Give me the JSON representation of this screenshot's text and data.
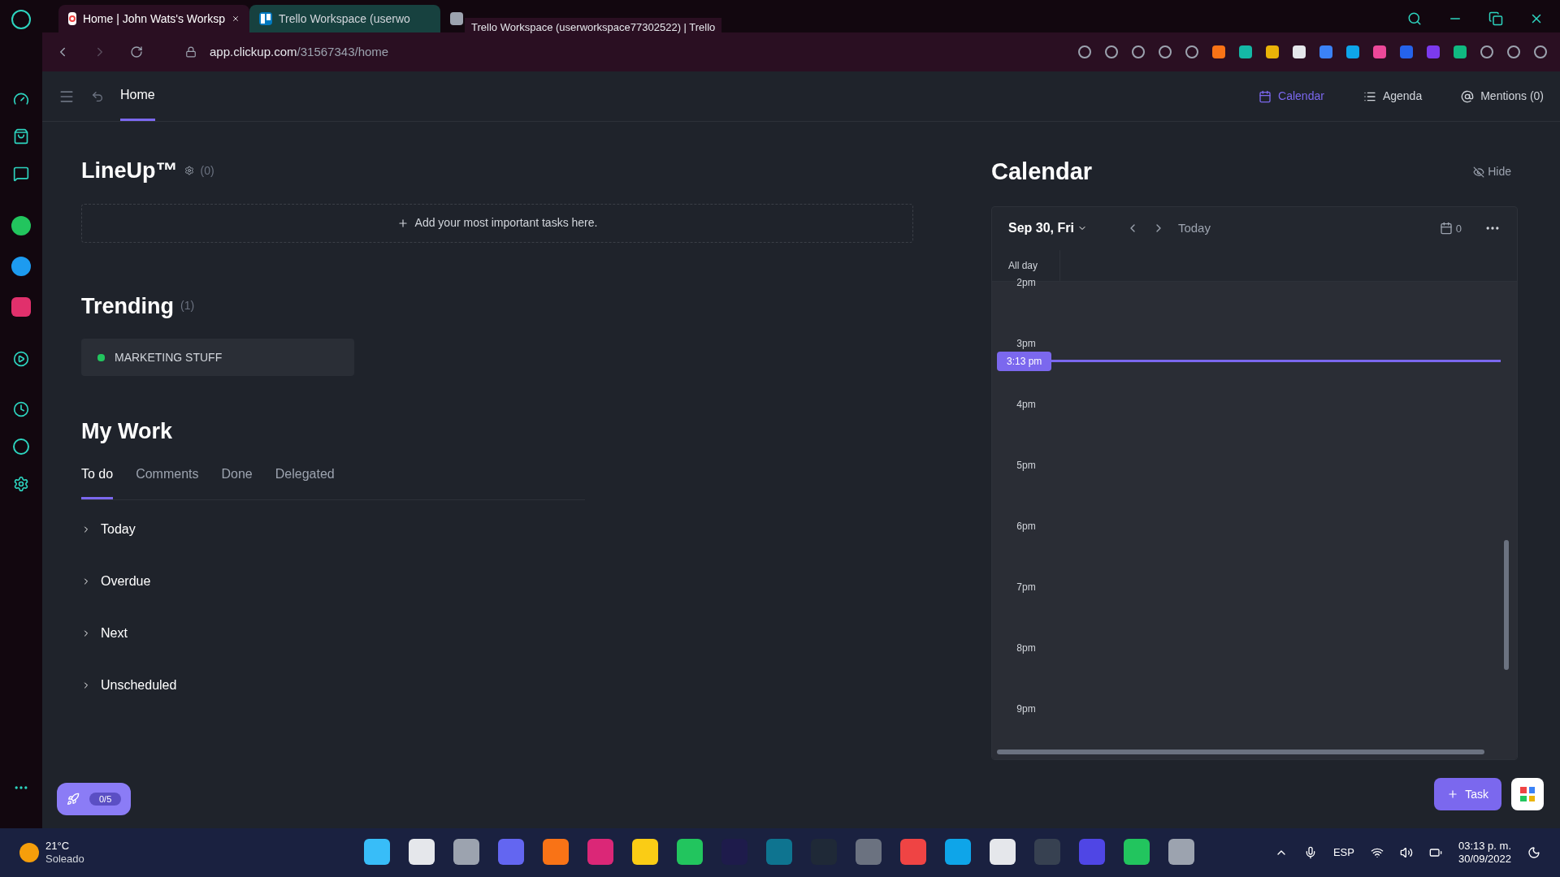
{
  "browser": {
    "tabs": [
      {
        "title": "Home | John Wats's Worksp",
        "selected": true,
        "kind": "clickup"
      },
      {
        "title": "Trello Workspace (userwo",
        "selected": false,
        "kind": "trello"
      },
      {
        "selected": false,
        "kind": "other"
      }
    ],
    "tooltip": "Trello Workspace (userworkspace77302522) | Trello",
    "url_host": "app.clickup.com",
    "url_path": "/31567343/home"
  },
  "header": {
    "title": "Home",
    "views": [
      {
        "label": "Calendar",
        "selected": true
      },
      {
        "label": "Agenda",
        "selected": false
      },
      {
        "label": "Mentions (0)",
        "selected": false
      }
    ]
  },
  "lineup": {
    "title": "LineUp™",
    "count": "(0)",
    "add_label": "Add your most important tasks here."
  },
  "trending": {
    "title": "Trending",
    "count": "(1)",
    "items": [
      {
        "label": "MARKETING STUFF",
        "color": "#22c55e"
      }
    ]
  },
  "my_work": {
    "title": "My Work",
    "tabs": [
      {
        "label": "To do",
        "selected": true
      },
      {
        "label": "Comments",
        "selected": false
      },
      {
        "label": "Done",
        "selected": false
      },
      {
        "label": "Delegated",
        "selected": false
      }
    ],
    "groups": [
      {
        "label": "Today",
        "expanded": false
      },
      {
        "label": "Overdue",
        "expanded": false
      },
      {
        "label": "Next",
        "expanded": false
      },
      {
        "label": "Unscheduled",
        "expanded": false
      }
    ]
  },
  "calendar": {
    "title": "Calendar",
    "hide_label": "Hide",
    "date": "Sep 30, Fri",
    "today_label": "Today",
    "event_count": "0",
    "all_day": "All day",
    "hours": [
      "2pm",
      "3pm",
      "4pm",
      "5pm",
      "6pm",
      "7pm",
      "8pm",
      "9pm"
    ],
    "now": "3:13 pm"
  },
  "onboarding_badge": "0/5",
  "task_button": "Task",
  "taskbar": {
    "temperature": "21°C",
    "weather": "Soleado",
    "language": "ESP",
    "time": "03:13 p. m.",
    "date": "30/09/2022"
  }
}
